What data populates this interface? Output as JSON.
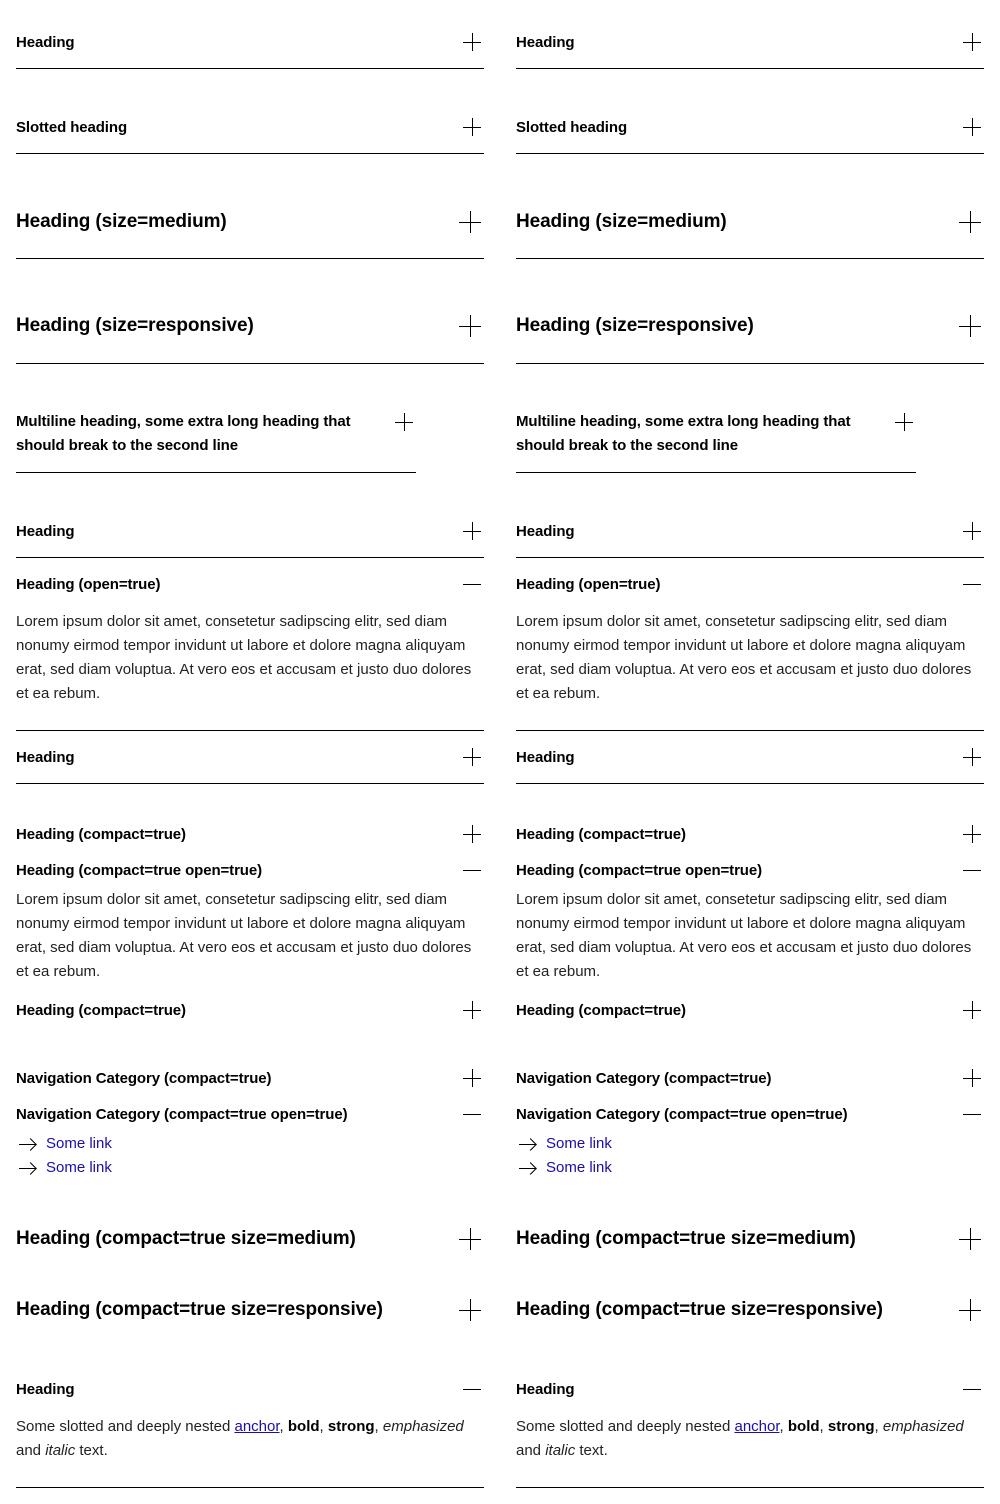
{
  "accordions": {
    "a1": "Heading",
    "a2": "Slotted heading",
    "a3": "Heading (size=medium)",
    "a4": "Heading (size=responsive)",
    "a5": "Multiline heading, some extra long heading that should break to the second line",
    "a6": "Heading",
    "a7": "Heading (open=true)",
    "a8": "Heading",
    "a9": "Heading (compact=true)",
    "a10": "Heading (compact=true open=true)",
    "a11": "Heading (compact=true)",
    "a12": "Navigation Category (compact=true)",
    "a13": "Navigation Category (compact=true open=true)",
    "a14": "Heading (compact=true size=medium)",
    "a15": "Heading (compact=true size=responsive)",
    "a16": "Heading"
  },
  "content": {
    "lorem": "Lorem ipsum dolor sit amet, consetetur sadipscing elitr, sed diam nonumy eirmod tempor invidunt ut labore et dolore magna aliquyam erat, sed diam voluptua. At vero eos et accusam et justo duo dolores et ea rebum.",
    "link_label": "Some link",
    "rich": {
      "prefix": "Some slotted and deeply nested ",
      "anchor": "anchor",
      "sep1": ", ",
      "bold": "bold",
      "sep2": ", ",
      "strong": "strong",
      "sep3": ", ",
      "emphasized": "emphasized",
      "mid": " and ",
      "italic": "italic",
      "suffix": " text."
    }
  },
  "icons": {
    "closed": "plus-icon",
    "open": "minus-icon",
    "link": "arrow-right-icon"
  },
  "colors": {
    "link": "#1a0dab",
    "divider": "#000000",
    "text": "#222222"
  }
}
